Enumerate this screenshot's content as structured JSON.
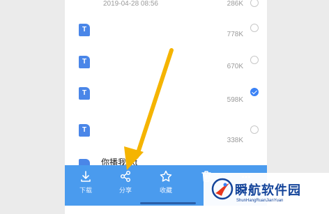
{
  "file_list": {
    "rows": [
      {
        "icon_letter": "T",
        "date": "2019-04-28 08:56",
        "size": "286K",
        "selected": false
      },
      {
        "icon_letter": "T",
        "size": "778K",
        "selected": false
      },
      {
        "icon_letter": "T",
        "size": "670K",
        "selected": false
      },
      {
        "icon_letter": "T",
        "size": "598K",
        "selected": true
      },
      {
        "icon_letter": "T",
        "size": "338K",
        "selected": false
      }
    ],
    "partial_file_name": "你播我.txt"
  },
  "toolbar": {
    "download_label": "下载",
    "share_label": "分享",
    "favorite_label": "收藏",
    "more_label": "..."
  },
  "watermark": {
    "title": "瞬航软件园",
    "subtitle": "ShunHangRuanJianYuan"
  },
  "colors": {
    "toolbar_bg": "#4a9bee",
    "file_icon": "#4a86e8",
    "checked_radio": "#3b82f6",
    "arrow": "#f5b400",
    "watermark_text": "#14449a"
  },
  "icons": [
    "file-txt-icon",
    "download-icon",
    "share-icon",
    "star-icon",
    "trash-icon",
    "more-icon",
    "radio-icon",
    "checkmark-icon"
  ]
}
